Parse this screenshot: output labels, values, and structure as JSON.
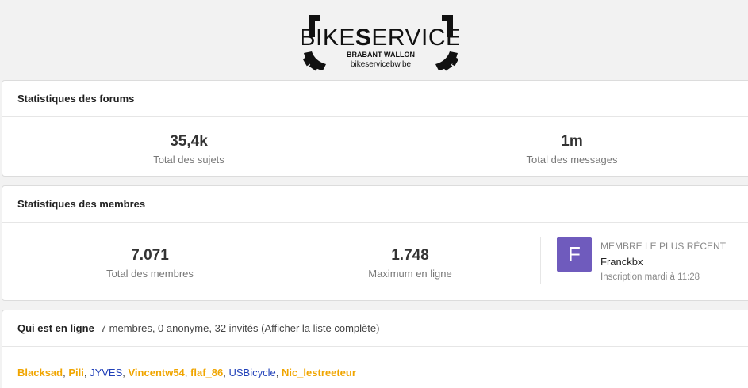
{
  "brand": {
    "logo_main_prefix": "BIKE",
    "logo_main_bold": "S",
    "logo_main_suffix": "ERVICE",
    "logo_sub": "BRABANT WALLON",
    "logo_url": "bikeservicebw.be"
  },
  "forum_stats": {
    "title": "Statistiques des forums",
    "items": [
      {
        "value": "35,4k",
        "label": "Total des sujets"
      },
      {
        "value": "1m",
        "label": "Total des messages"
      }
    ]
  },
  "member_stats": {
    "title": "Statistiques des membres",
    "items": [
      {
        "value": "7.071",
        "label": "Total des membres"
      },
      {
        "value": "1.748",
        "label": "Maximum en ligne"
      }
    ],
    "newest": {
      "avatar_letter": "F",
      "avatar_color": "#6f5bbd",
      "caption": "MEMBRE LE PLUS RÉCENT",
      "name": "Franckbx",
      "date": "Inscription mardi à 11:28"
    }
  },
  "online": {
    "title": "Qui est en ligne",
    "summary": "7 membres, 0 anonyme, 32 invités (Afficher la liste complète)",
    "users": [
      {
        "name": "Blacksad",
        "style": "mod"
      },
      {
        "name": "Pili",
        "style": "mod"
      },
      {
        "name": "JYVES",
        "style": "reg"
      },
      {
        "name": "Vincentw54",
        "style": "mod"
      },
      {
        "name": "flaf_86",
        "style": "mod"
      },
      {
        "name": "USBicycle",
        "style": "reg"
      },
      {
        "name": "Nic_lestreeteur",
        "style": "mod"
      }
    ],
    "separator": ", ",
    "colors": {
      "mod": "#f0a500",
      "reg": "#1f3fb8"
    }
  }
}
